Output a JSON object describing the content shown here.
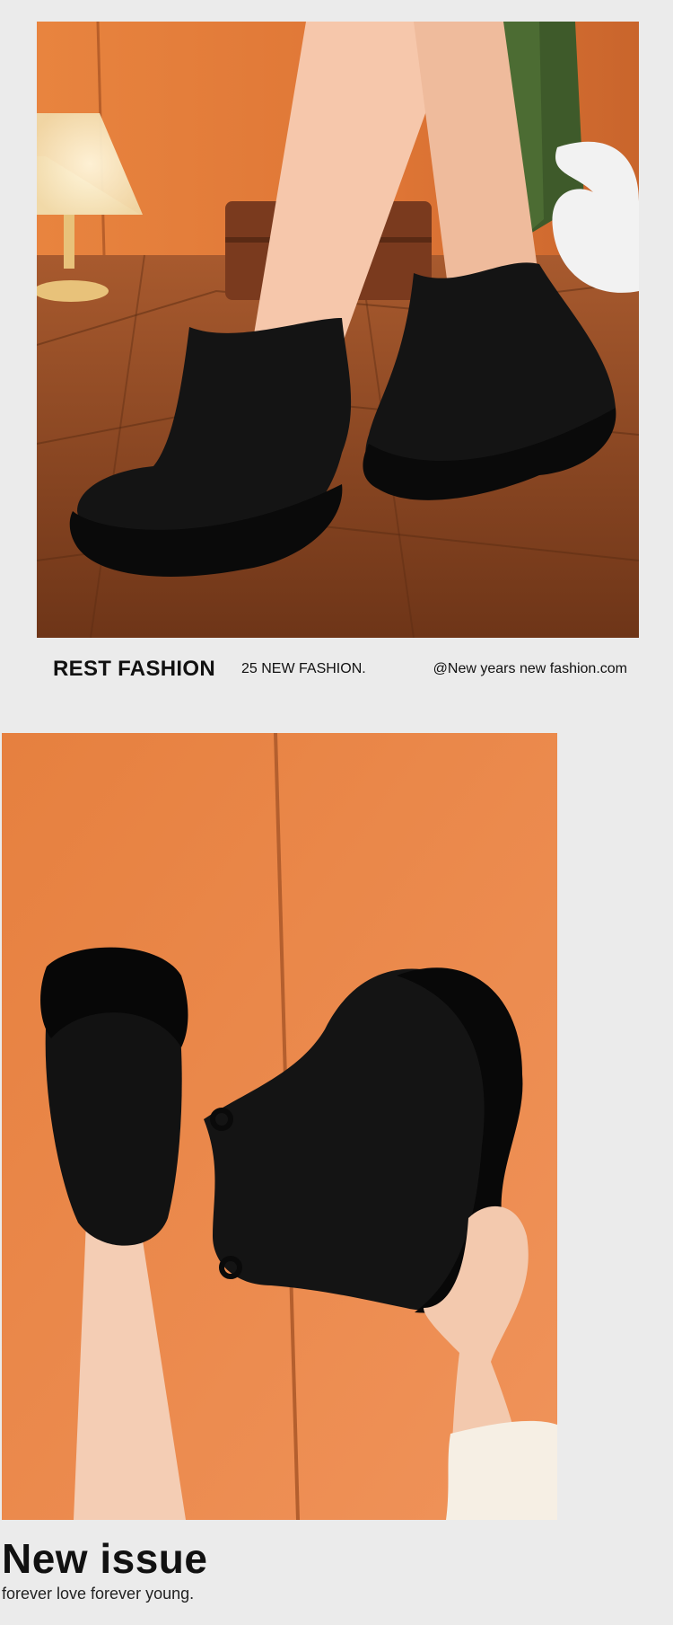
{
  "photos": {
    "top": {
      "name": "two black chelsea platform boots worn on wooden floor",
      "icon": "product-photo"
    },
    "bottom": {
      "name": "black chelsea platform boots held in hand against orange wall",
      "icon": "product-photo"
    }
  },
  "caption": {
    "brand": "REST FASHION",
    "tagline": "25 NEW FASHION.",
    "handle": "@New years new fashion.com"
  },
  "footer": {
    "title": "New issue",
    "subtitle": "forever love forever young."
  },
  "colors": {
    "background": "#ebebeb",
    "wall_orange": "#e07a3a",
    "floor_wood": "#8a4a25",
    "boot_black": "#121212"
  }
}
